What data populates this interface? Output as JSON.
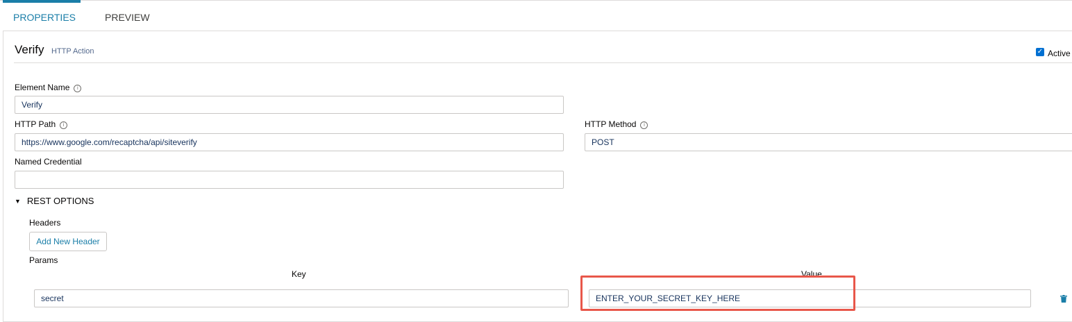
{
  "tabs": [
    {
      "label": "PROPERTIES",
      "active": true
    },
    {
      "label": "PREVIEW",
      "active": false
    }
  ],
  "header": {
    "title": "Verify",
    "subtitle": "HTTP Action",
    "active_label": "Active",
    "active_checked": true
  },
  "form": {
    "element_name": {
      "label": "Element Name",
      "value": "Verify"
    },
    "http_path": {
      "label": "HTTP Path",
      "value": "https://www.google.com/recaptcha/api/siteverify"
    },
    "http_method": {
      "label": "HTTP Method",
      "value": "POST"
    },
    "named_credential": {
      "label": "Named Credential",
      "value": ""
    }
  },
  "rest_options": {
    "label": "REST OPTIONS",
    "headers_label": "Headers",
    "add_header_label": "Add New Header",
    "params_label": "Params",
    "key_header": "Key",
    "value_header": "Value",
    "params": [
      {
        "key": "secret",
        "value": "ENTER_YOUR_SECRET_KEY_HERE"
      }
    ]
  },
  "icons": {
    "info": "info-icon",
    "trash": "trash-icon",
    "checkbox": "checkbox-checked-icon"
  },
  "colors": {
    "accent": "#1a7ea8",
    "highlight": "#e8574a",
    "checkbox": "#0070d2"
  }
}
